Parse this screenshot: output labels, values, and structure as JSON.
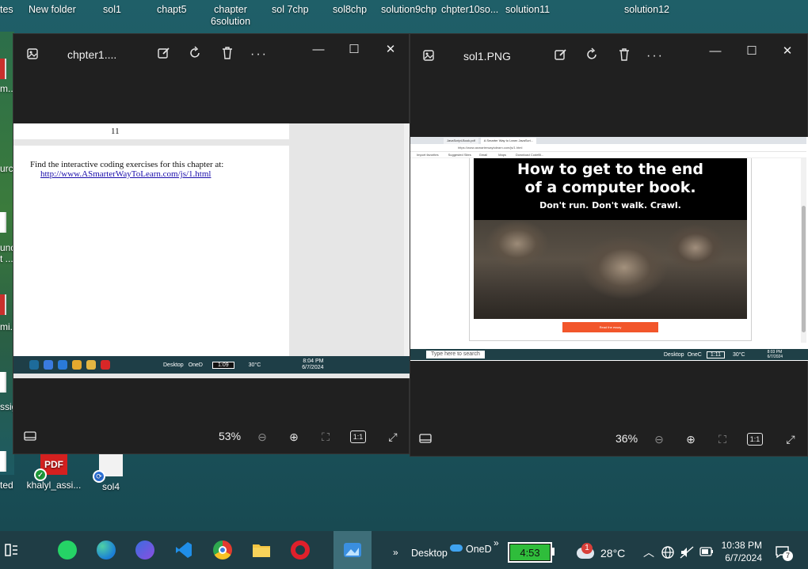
{
  "desktop": {
    "top_labels": [
      "tes",
      "New folder",
      "sol1",
      "chapt5",
      "chapter\n6solution",
      "sol 7chp",
      "sol8chp",
      "solution9chp",
      "chpter10so...",
      "solution11",
      "solution12"
    ],
    "side_labels": [
      "m...",
      "urce",
      "und",
      "t ...",
      "mi...",
      "ssig",
      "ted"
    ],
    "bottom_icons": [
      {
        "label": "khalyl_assi...",
        "badge": "PDF"
      },
      {
        "label": "sol4"
      }
    ]
  },
  "left_window": {
    "title": "chpter1....",
    "tools": [
      "edit-icon",
      "rotate-icon",
      "delete-icon",
      "more-icon"
    ],
    "zoom": "53%",
    "page_number": "11",
    "doc_text": "Find the interactive coding exercises for this chapter at:",
    "doc_link": "http://www.ASmarterWayToLearn.com/js/1.html",
    "mini_taskbar": {
      "battery": "1:09",
      "desktop": "Desktop",
      "onedrive": "OneD",
      "temp": "30°C",
      "time": "8:04 PM",
      "date": "6/7/2024"
    }
  },
  "right_window": {
    "title": "sol1.PNG",
    "zoom": "36%",
    "browser": {
      "tabs": [
        "JavaScript-Book.pdf",
        "A Smarter Way to Learn JavaScri..."
      ],
      "url": "https://www.asmarterwaytolearn.com/js/1.html",
      "favorites": [
        "Import favorites",
        "Suggested Sites",
        "Gmail",
        "Maps",
        "Download CodeBl..."
      ]
    },
    "site": {
      "headline": "How to get to the end of a computer book.",
      "headline_line1": "How to get to the end",
      "headline_line2": "of a computer book.",
      "subhead": "Don't run. Don't walk. Crawl.",
      "cta": "Read the essay"
    },
    "mini_taskbar": {
      "search_placeholder": "Type here to search",
      "desktop": "Desktop",
      "onedrive": "OneC",
      "battery": "1:11",
      "temp": "30°C",
      "time": "8:03 PM",
      "date": "6/7/2024"
    }
  },
  "taskbar": {
    "apps": [
      "widgets-icon",
      "whatsapp-icon",
      "edge-icon",
      "copilot-icon",
      "vscode-icon",
      "chrome-icon",
      "file-explorer-icon",
      "opera-icon",
      "photos-icon"
    ],
    "desktop_label": "Desktop",
    "onedrive_label": "OneD",
    "battery_time": "4:53",
    "weather_badge": "1",
    "temperature": "28°C",
    "time": "10:38 PM",
    "date": "6/7/2024",
    "notifications": "7"
  }
}
